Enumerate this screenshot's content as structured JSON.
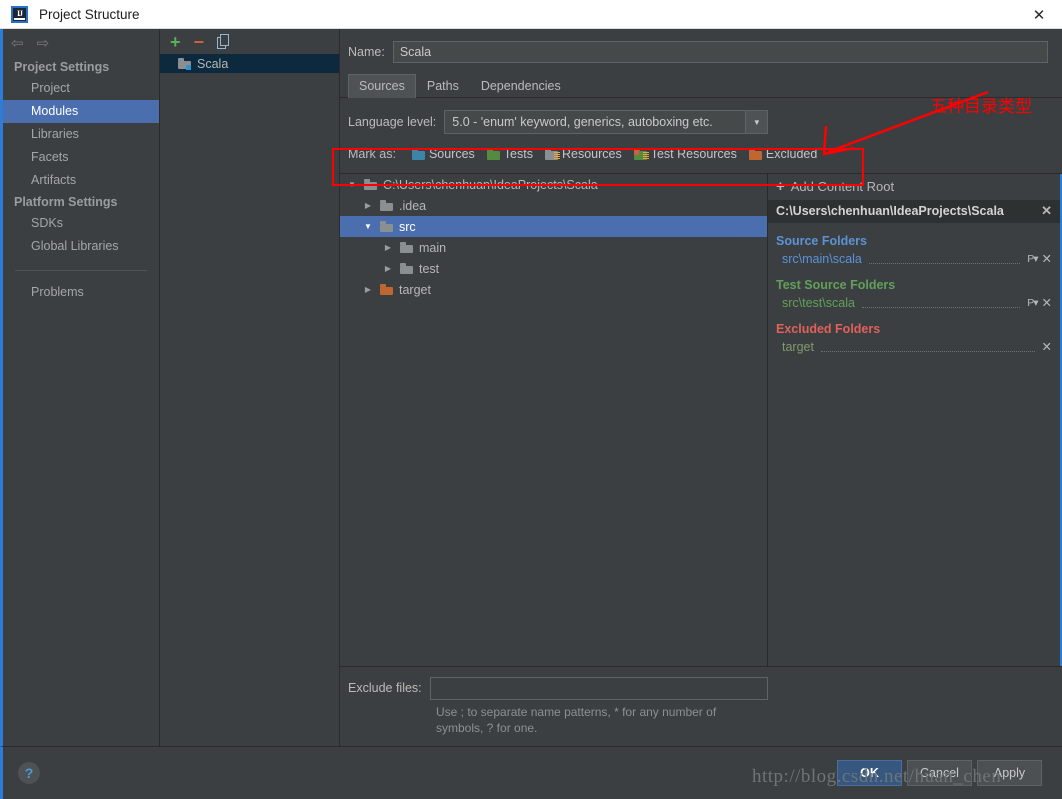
{
  "window": {
    "title": "Project Structure",
    "close_label": "✕",
    "app_icon": "intellij-idea-icon"
  },
  "sidebar": {
    "back_icon": "⇦",
    "forward_icon": "⇨",
    "groups": [
      {
        "title": "Project Settings",
        "items": [
          {
            "label": "Project",
            "selected": false
          },
          {
            "label": "Modules",
            "selected": true
          },
          {
            "label": "Libraries",
            "selected": false
          },
          {
            "label": "Facets",
            "selected": false
          },
          {
            "label": "Artifacts",
            "selected": false
          }
        ]
      },
      {
        "title": "Platform Settings",
        "items": [
          {
            "label": "SDKs",
            "selected": false
          },
          {
            "label": "Global Libraries",
            "selected": false
          }
        ]
      }
    ],
    "problems_label": "Problems"
  },
  "modules": {
    "toolbar": {
      "add_label": "+",
      "remove_label": "−",
      "copy_label": "copy-icon"
    },
    "items": [
      {
        "label": "Scala",
        "selected": true
      }
    ]
  },
  "module_form": {
    "name_label": "Name:",
    "name_value": "Scala",
    "tabs": [
      {
        "label": "Sources",
        "active": true
      },
      {
        "label": "Paths",
        "active": false
      },
      {
        "label": "Dependencies",
        "active": false
      }
    ],
    "language_level_label": "Language level:",
    "language_level_value": "5.0 - 'enum' keyword, generics, autoboxing etc.",
    "language_level_arrow": "▼",
    "mark_as_label": "Mark as:",
    "mark_as_options": [
      {
        "label": "Sources",
        "mnemonic": "S",
        "rest": "ources",
        "color": "blue"
      },
      {
        "label": "Tests",
        "mnemonic": "T",
        "rest": "ests",
        "color": "green"
      },
      {
        "label": "Resources",
        "mnemonic": "",
        "rest": "Resources",
        "color": "gray-lines"
      },
      {
        "label": "Test Resources",
        "mnemonic": "",
        "rest": "Test Resources",
        "color": "green-lines"
      },
      {
        "label": "Excluded",
        "mnemonic": "E",
        "rest": "xcluded",
        "color": "orange"
      }
    ]
  },
  "tree": {
    "rows": [
      {
        "label": "C:\\Users\\chenhuan\\IdeaProjects\\Scala",
        "indent": 0,
        "twisty": "▼",
        "icon": "folder-gray",
        "selected": false
      },
      {
        "label": ".idea",
        "indent": 1,
        "twisty": "▶",
        "icon": "folder-gray",
        "selected": false
      },
      {
        "label": "src",
        "indent": 1,
        "twisty": "▼",
        "icon": "folder-gray",
        "selected": true
      },
      {
        "label": "main",
        "indent": 2,
        "twisty": "▶",
        "icon": "folder-gray",
        "selected": false
      },
      {
        "label": "test",
        "indent": 2,
        "twisty": "▶",
        "icon": "folder-gray",
        "selected": false
      },
      {
        "label": "target",
        "indent": 1,
        "twisty": "▶",
        "icon": "folder-orange",
        "selected": false
      }
    ]
  },
  "content_roots": {
    "add_label": "Add Content Root",
    "add_icon": "+",
    "root_path": "C:\\Users\\chenhuan\\IdeaProjects\\Scala",
    "root_close": "✕",
    "groups": [
      {
        "title": "Source Folders",
        "kind": "src",
        "color": "#5b93d6",
        "entries": [
          {
            "path": "src\\main\\scala",
            "has_prefix_button": true,
            "prefix_label": "P",
            "close_label": "✕"
          }
        ]
      },
      {
        "title": "Test Source Folders",
        "kind": "test",
        "color": "#62a05a",
        "entries": [
          {
            "path": "src\\test\\scala",
            "has_prefix_button": true,
            "prefix_label": "P",
            "close_label": "✕"
          }
        ]
      },
      {
        "title": "Excluded Folders",
        "kind": "excl",
        "color": "#e2605a",
        "entries": [
          {
            "path": "target",
            "has_prefix_button": false,
            "prefix_label": "",
            "close_label": "✕"
          }
        ]
      }
    ]
  },
  "exclude_files": {
    "label": "Exclude files:",
    "value": "",
    "hint": "Use ; to separate name patterns, * for any number of symbols, ? for one."
  },
  "footer": {
    "help_label": "?",
    "buttons": [
      {
        "label": "OK",
        "default": true
      },
      {
        "label": "Cancel",
        "default": false
      },
      {
        "label": "Apply",
        "default": false
      }
    ]
  },
  "annotations": {
    "callout_text": "五种目录类型",
    "callout_color": "#ff0000",
    "watermark": "http://blog.csdn.net/huan_chen"
  }
}
